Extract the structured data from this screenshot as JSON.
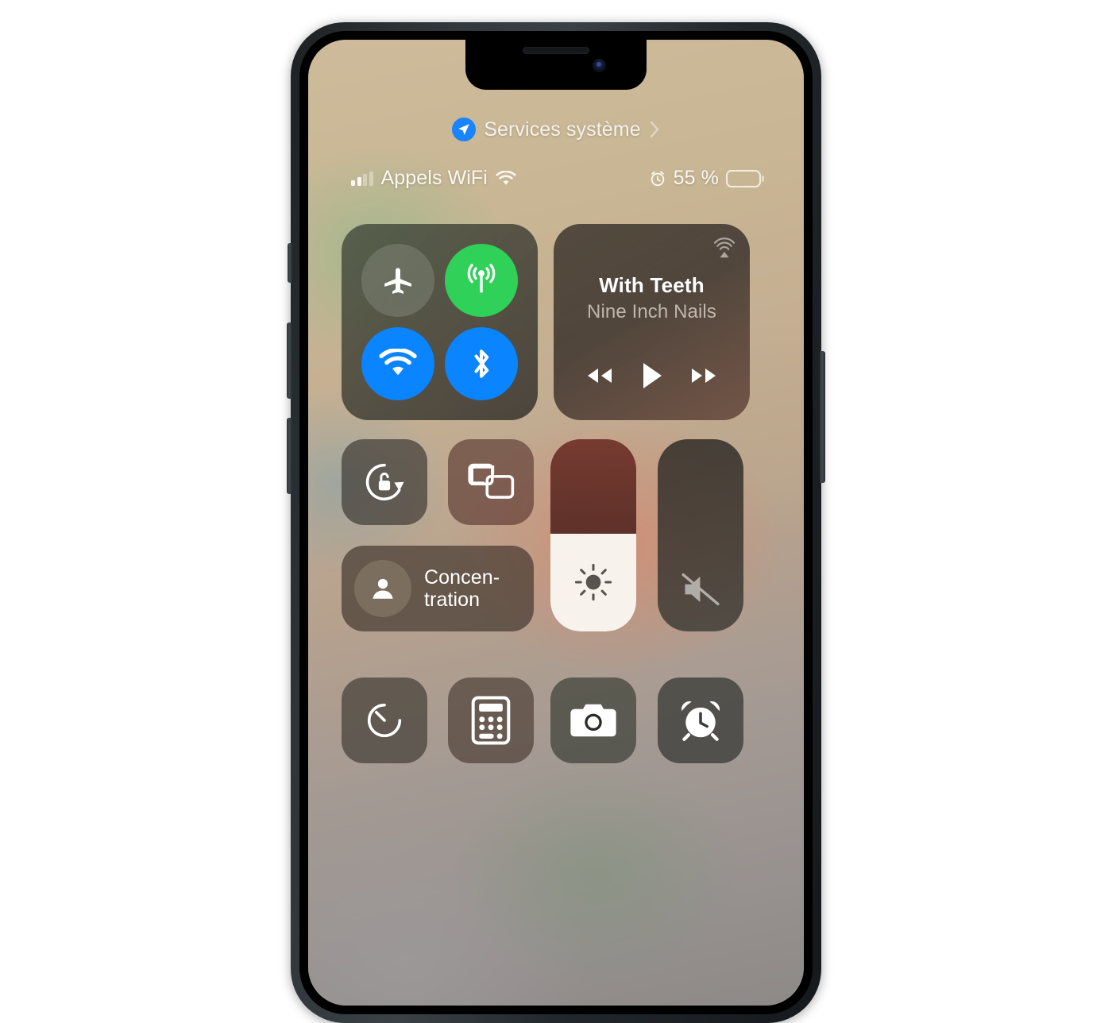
{
  "device": {
    "name": "iphone",
    "notch": {
      "speaker": "earpiece-speaker",
      "camera": "front-camera"
    },
    "buttons": [
      "ringer-switch",
      "volume-up-button",
      "volume-down-button",
      "power-button"
    ]
  },
  "location_banner": {
    "icon": "location-arrow-icon",
    "label": "Services système",
    "chevron": "chevron-right-icon",
    "icon_color": "#1a84ff"
  },
  "status_bar": {
    "signal": {
      "icon": "cellular-signal-icon",
      "bars_total": 4,
      "bars_active": 2
    },
    "carrier": "Appels WiFi",
    "wifi_icon": "wifi-icon",
    "alarm_icon": "alarm-clock-icon",
    "battery_percent_label": "55 %",
    "battery_level": 55,
    "battery_icon": "battery-icon"
  },
  "connectivity": {
    "name": "connectivity-module",
    "toggles": [
      {
        "name": "airplane-mode-toggle",
        "icon": "airplane-icon",
        "state": "off",
        "color": "#8b9084"
      },
      {
        "name": "cellular-data-toggle",
        "icon": "cellular-antenna-icon",
        "state": "on",
        "color": "#30d158"
      },
      {
        "name": "wifi-toggle",
        "icon": "wifi-icon",
        "state": "on",
        "color": "#0a84ff"
      },
      {
        "name": "bluetooth-toggle",
        "icon": "bluetooth-icon",
        "state": "on",
        "color": "#0a84ff"
      }
    ]
  },
  "media": {
    "name": "media-module",
    "airplay_icon": "airplay-audio-icon",
    "title": "With Teeth",
    "artist": "Nine Inch Nails",
    "controls": [
      {
        "name": "rewind-button",
        "icon": "rewind-icon"
      },
      {
        "name": "play-button",
        "icon": "play-icon"
      },
      {
        "name": "fast-forward-button",
        "icon": "fast-forward-icon"
      }
    ]
  },
  "tiles": {
    "rotation_lock": {
      "name": "rotation-lock-tile",
      "icon": "rotation-lock-icon",
      "state": "off"
    },
    "screen_mirroring": {
      "name": "screen-mirroring-tile",
      "icon": "screen-mirroring-icon"
    },
    "focus": {
      "name": "focus-tile",
      "icon": "person-icon",
      "label": "Concen-\ntration"
    }
  },
  "sliders": {
    "brightness": {
      "name": "brightness-slider",
      "icon": "brightness-sun-icon",
      "value": 51
    },
    "volume": {
      "name": "volume-slider",
      "icon": "volume-muted-icon",
      "value": 0,
      "muted": true
    }
  },
  "shortcuts": [
    {
      "name": "timer-tile",
      "icon": "timer-icon"
    },
    {
      "name": "calculator-tile",
      "icon": "calculator-icon"
    },
    {
      "name": "camera-tile",
      "icon": "camera-icon"
    },
    {
      "name": "alarm-tile",
      "icon": "alarm-clock-icon"
    }
  ]
}
